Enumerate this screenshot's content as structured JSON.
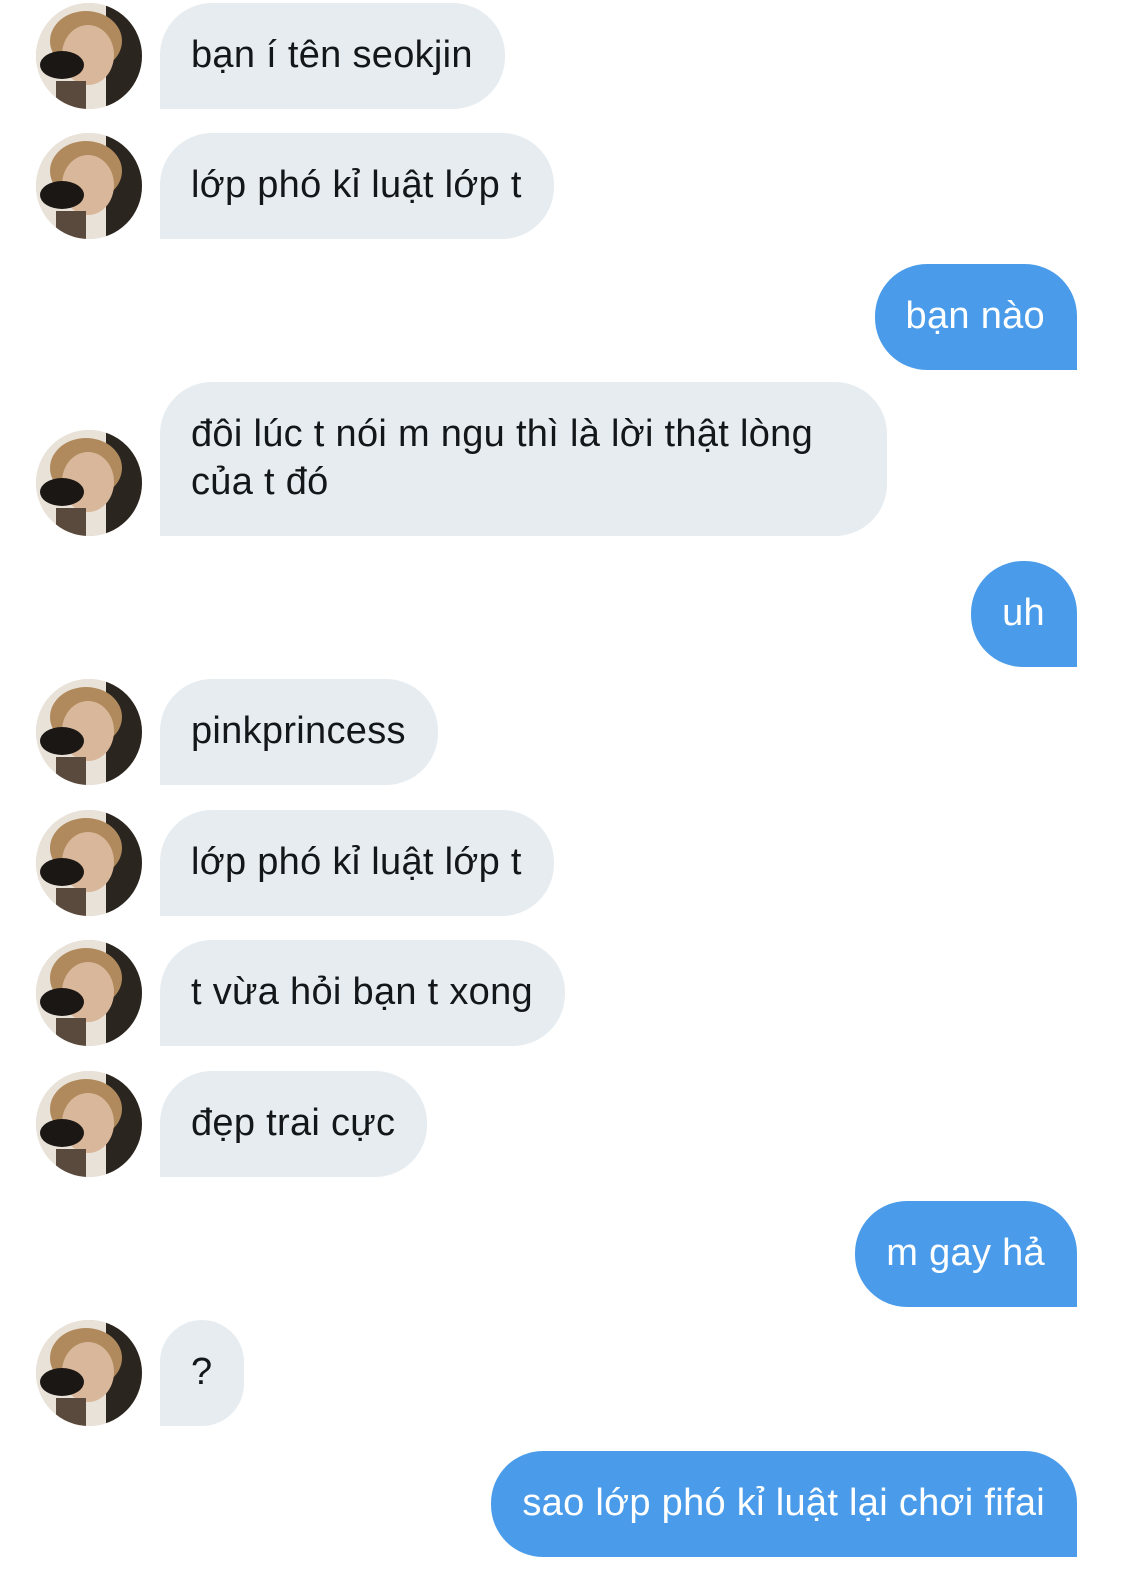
{
  "colors": {
    "received_bubble": "#e6ecf0",
    "sent_bubble": "#4a9cea",
    "received_text": "#14171a",
    "sent_text": "#ffffff"
  },
  "contact": {
    "avatar_icon": "contact-avatar-photo"
  },
  "messages": [
    {
      "from": "them",
      "text": "bạn í tên seokjin"
    },
    {
      "from": "them",
      "text": "lớp phó kỉ luật lớp t"
    },
    {
      "from": "me",
      "text": "bạn nào"
    },
    {
      "from": "them",
      "text": "đôi lúc t nói m ngu thì là lời thật lòng của t đó"
    },
    {
      "from": "me",
      "text": "uh"
    },
    {
      "from": "them",
      "text": "pinkprincess"
    },
    {
      "from": "them",
      "text": "lớp phó kỉ luật lớp t"
    },
    {
      "from": "them",
      "text": "t vừa hỏi bạn t xong"
    },
    {
      "from": "them",
      "text": "đẹp trai cực"
    },
    {
      "from": "me",
      "text": "m gay hả"
    },
    {
      "from": "them",
      "text": "?"
    },
    {
      "from": "me",
      "text": "sao lớp phó kỉ luật lại chơi fifai"
    }
  ]
}
